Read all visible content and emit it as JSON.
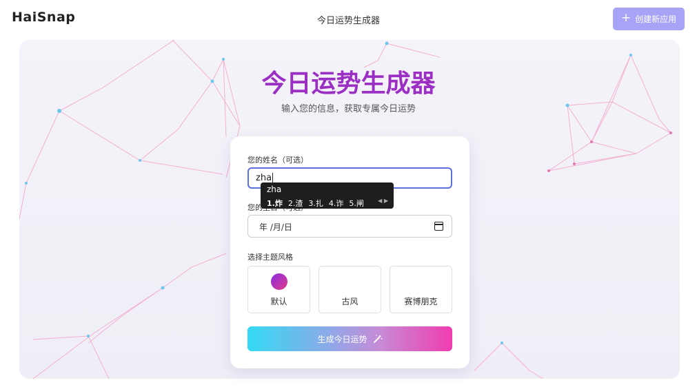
{
  "header": {
    "logo": "HaiSnap",
    "title": "今日运势生成器",
    "create_button": "创建新应用"
  },
  "hero": {
    "title": "今日运势生成器",
    "subtitle": "输入您的信息，获取专属今日运势"
  },
  "form": {
    "name_label": "您的姓名（可选）",
    "name_value": "zha",
    "birth_label": "您的生日（可选）",
    "date_placeholder": "年 /月/日",
    "theme_label": "选择主题风格",
    "themes": [
      {
        "label": "默认"
      },
      {
        "label": "古风"
      },
      {
        "label": "赛博朋克"
      }
    ],
    "submit": "生成今日运势"
  },
  "ime": {
    "composition": "zha",
    "candidates": [
      "1.炸",
      "2.渣",
      "3.扎",
      "4.诈",
      "5.闸"
    ]
  },
  "colors": {
    "accent": "#a7a3f6",
    "title_gradient_start": "#7b3fd0",
    "title_gradient_end": "#d63aa0"
  }
}
